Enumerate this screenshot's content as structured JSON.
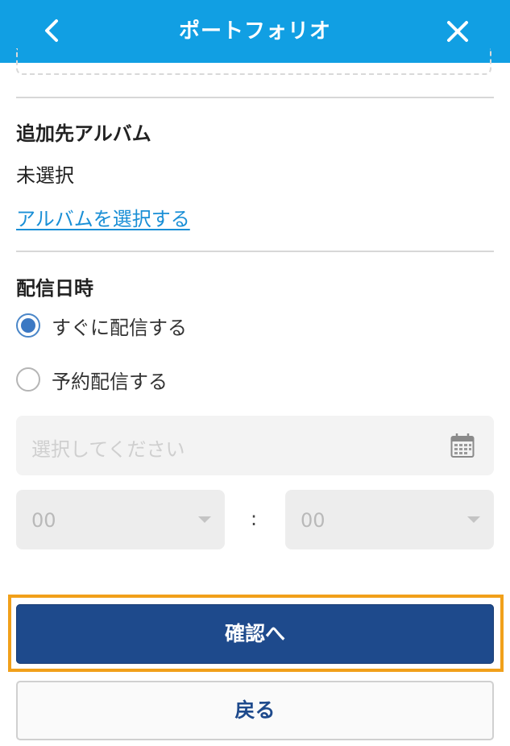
{
  "header": {
    "title": "ポートフォリオ",
    "back_icon": "chevron-left-icon",
    "close_icon": "close-icon",
    "background_color": "#119fe3"
  },
  "album": {
    "section_title": "追加先アルバム",
    "status": "未選択",
    "select_link": "アルバムを選択する"
  },
  "delivery": {
    "section_title": "配信日時",
    "options": [
      {
        "label": "すぐに配信する",
        "checked": true
      },
      {
        "label": "予約配信する",
        "checked": false
      }
    ],
    "date_placeholder": "選択してください",
    "calendar_icon": "calendar-icon",
    "hour_value": "00",
    "minute_value": "00",
    "separator": ":"
  },
  "actions": {
    "confirm_label": "確認へ",
    "back_label": "戻る",
    "confirm_color": "#1e4a8c",
    "highlight_color": "#f1a01a"
  }
}
